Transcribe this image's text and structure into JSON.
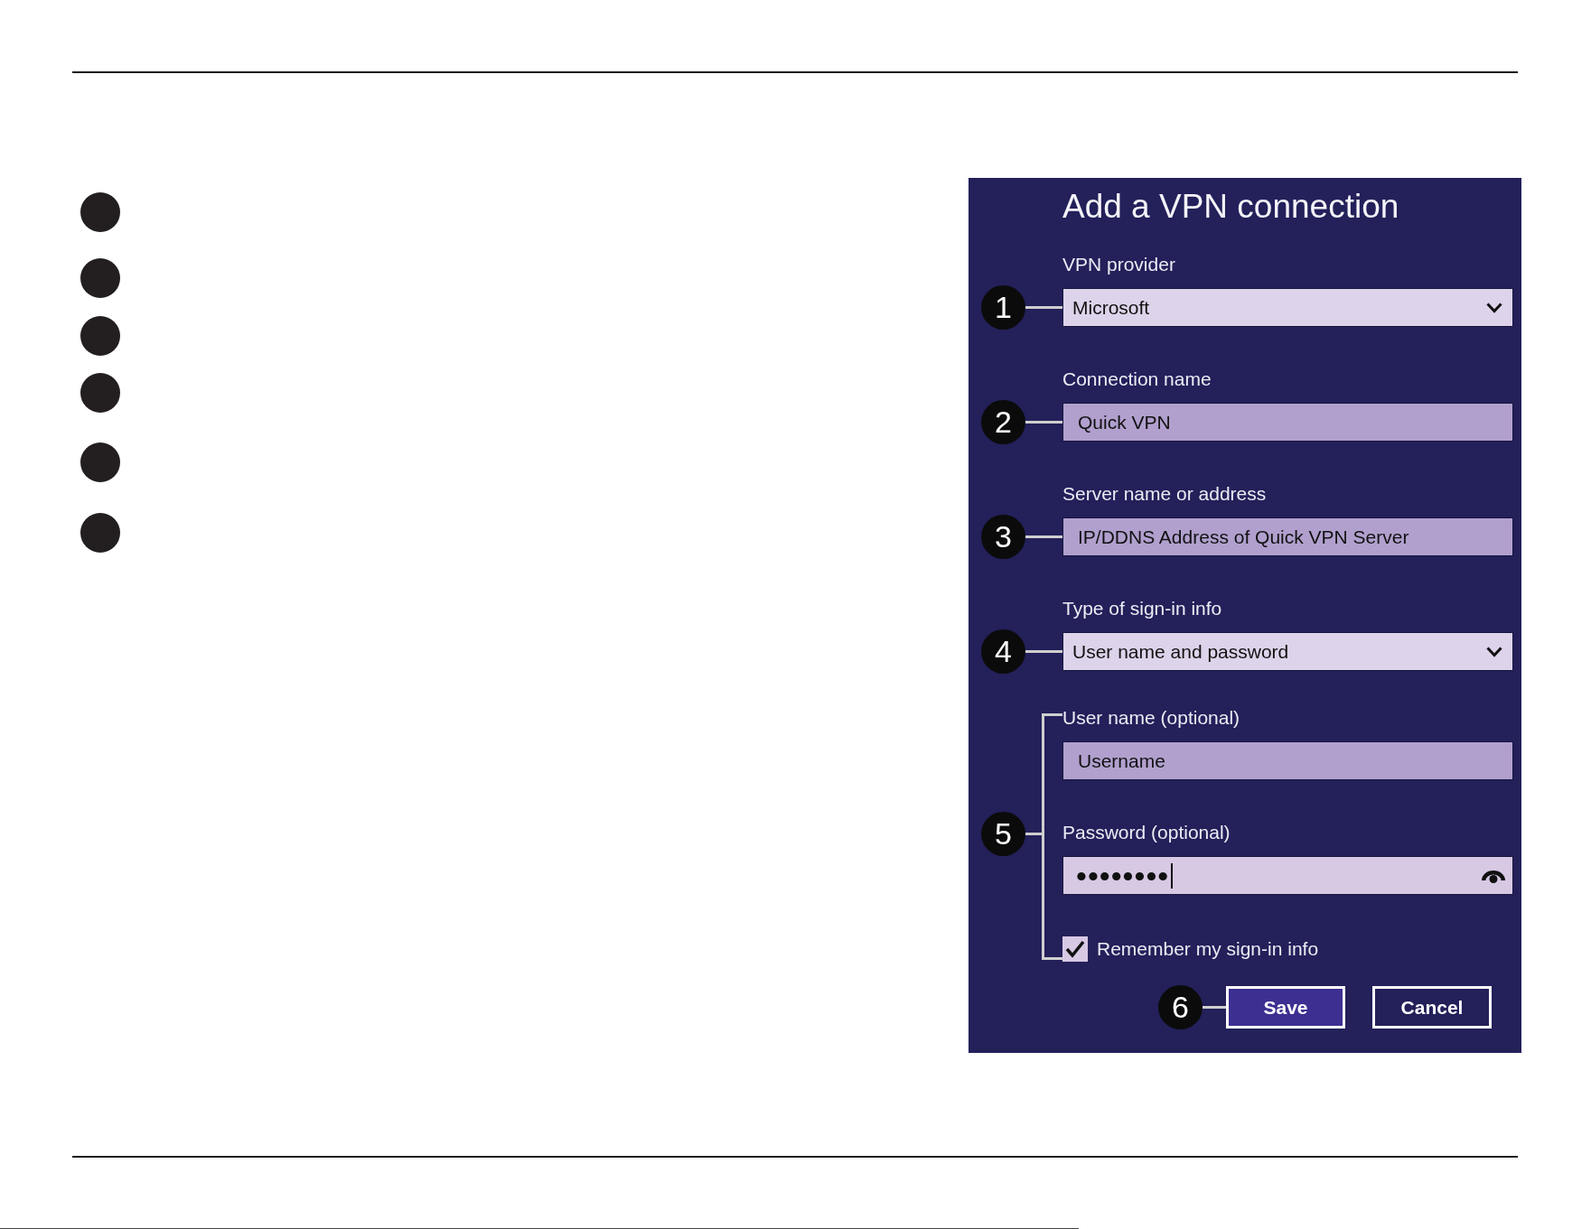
{
  "bullets": [
    {
      "kind": "dot"
    },
    {
      "kind": "dot"
    },
    {
      "kind": "dot"
    },
    {
      "kind": "dot"
    },
    {
      "kind": "dot"
    },
    {
      "kind": "dot"
    }
  ],
  "dialog": {
    "title": "Add a VPN connection",
    "fields": [
      {
        "kind": "dropdown",
        "callout": "1",
        "label": "VPN provider",
        "value": "Microsoft"
      },
      {
        "kind": "text",
        "callout": "2",
        "label": "Connection name",
        "value": "Quick VPN"
      },
      {
        "kind": "text",
        "callout": "3",
        "label": "Server name or address",
        "value": "IP/DDNS Address of Quick VPN Server"
      },
      {
        "kind": "dropdown",
        "callout": "4",
        "label": "Type of sign-in info",
        "value": "User name and password"
      }
    ],
    "sign_in": {
      "callout": "5",
      "fields": [
        {
          "kind": "text",
          "label": "User name (optional)",
          "value": "Username",
          "focused": false
        },
        {
          "kind": "password",
          "label": "Password (optional)",
          "value": "••••••••",
          "focused": true
        }
      ],
      "remember": {
        "label": "Remember my sign-in info",
        "checked": true
      }
    },
    "actions": {
      "callout": "6",
      "buttons": [
        {
          "label": "Save",
          "default": true
        },
        {
          "label": "Cancel",
          "default": false
        }
      ]
    }
  }
}
